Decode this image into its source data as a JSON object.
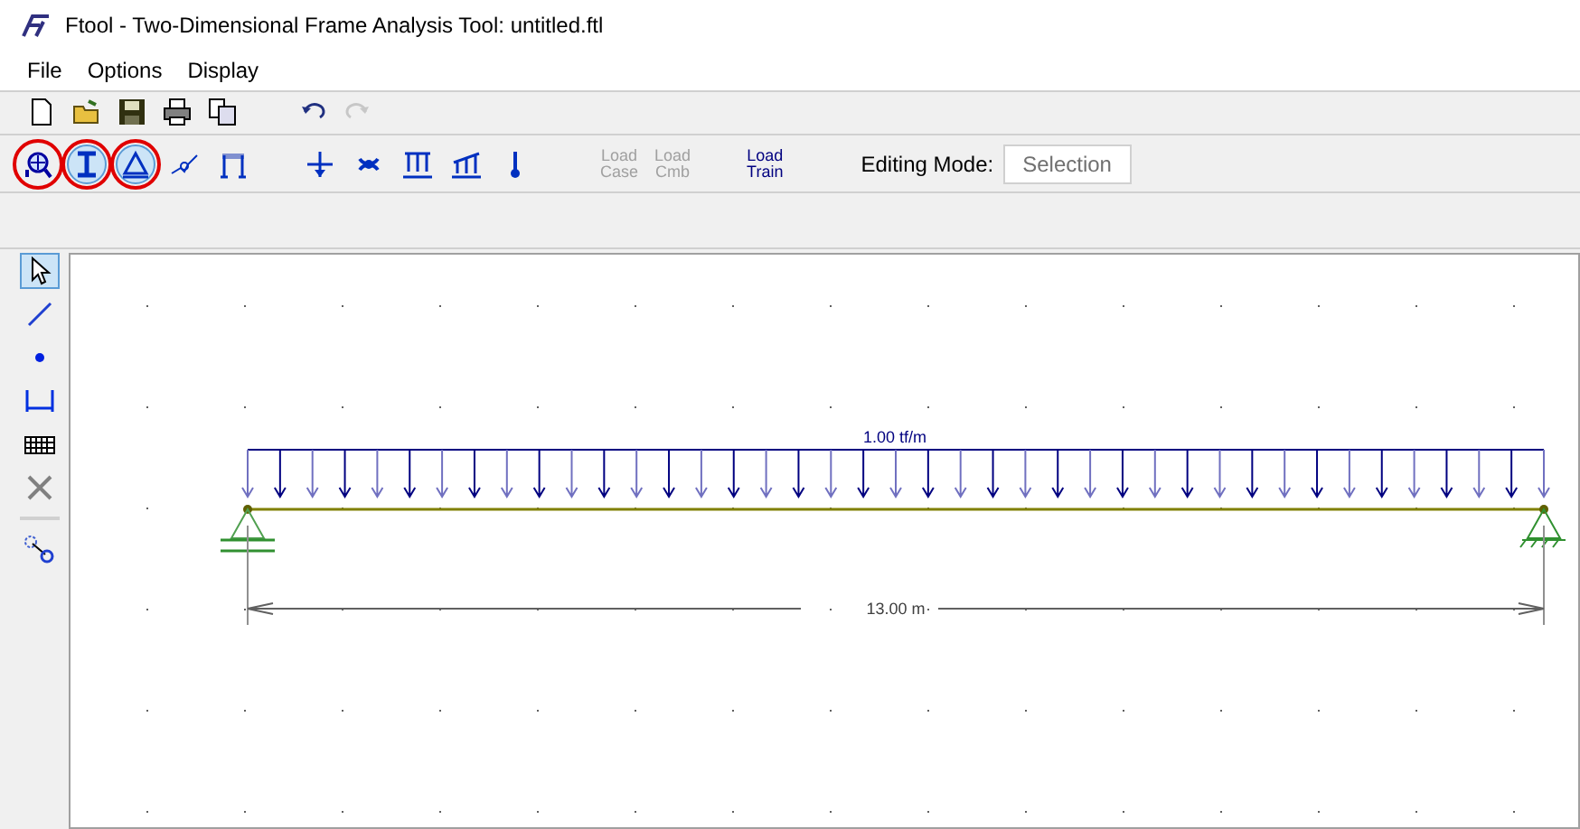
{
  "window": {
    "title": "Ftool - Two-Dimensional Frame Analysis Tool: untitled.ftl"
  },
  "menu": [
    "File",
    "Options",
    "Display"
  ],
  "toolbar": [
    {
      "kind": "new"
    },
    {
      "kind": "open"
    },
    {
      "kind": "save"
    },
    {
      "kind": "print"
    },
    {
      "kind": "copy"
    },
    {
      "kind": "gap"
    },
    {
      "kind": "undo",
      "disabled": false
    },
    {
      "kind": "redo",
      "disabled": true
    }
  ],
  "attribute_bar": {
    "tools": [
      {
        "kind": "material",
        "selected": false,
        "circled": true
      },
      {
        "kind": "section",
        "selected": true,
        "circled": true
      },
      {
        "kind": "support",
        "selected": true,
        "circled": true
      },
      {
        "kind": "spring",
        "selected": false,
        "circled": false
      },
      {
        "kind": "hinge",
        "selected": false,
        "circled": false
      },
      {
        "kind": "gap"
      },
      {
        "kind": "nodal-load",
        "selected": false,
        "circled": false
      },
      {
        "kind": "moment",
        "selected": false,
        "circled": false
      },
      {
        "kind": "uniform-load",
        "selected": false,
        "circled": false
      },
      {
        "kind": "linear-load",
        "selected": false,
        "circled": false
      },
      {
        "kind": "thermal",
        "selected": false,
        "circled": false
      }
    ],
    "load_buttons": [
      {
        "line_1": "Load",
        "line_2": "Case",
        "disabled": true
      },
      {
        "line_1": "Load",
        "line_2": "Cmb",
        "disabled": true
      },
      {
        "line_1": "Load",
        "line_2": "Train",
        "disabled": false
      }
    ],
    "editing_mode": {
      "label": "Editing Mode:",
      "value": "Selection"
    }
  },
  "side_tools": [
    {
      "kind": "select",
      "selected": true
    },
    {
      "kind": "member",
      "selected": false
    },
    {
      "kind": "node",
      "selected": false
    },
    {
      "kind": "dimension",
      "selected": false
    },
    {
      "kind": "grid",
      "selected": false
    },
    {
      "kind": "delete",
      "selected": false
    },
    {
      "kind": "divider"
    },
    {
      "kind": "zoom-node",
      "selected": false
    }
  ],
  "canvas": {
    "load_label": "1.00 tf/m",
    "dimension_label": "13.00 m"
  }
}
